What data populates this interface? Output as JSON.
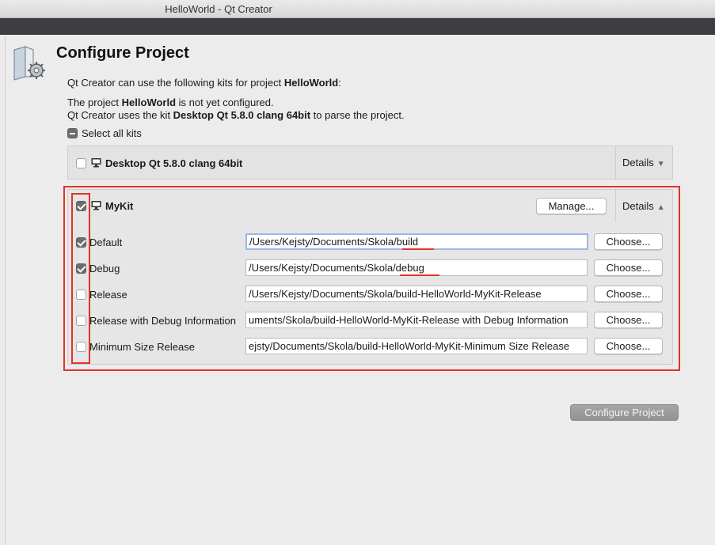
{
  "window": {
    "title": "HelloWorld - Qt Creator"
  },
  "page": {
    "heading": "Configure Project",
    "intro_prefix": "Qt Creator can use the following kits for project ",
    "intro_project": "HelloWorld",
    "intro_suffix": ":",
    "status1_prefix": "The project ",
    "status1_project": "HelloWorld",
    "status1_suffix": " is not yet configured.",
    "status2_prefix": "Qt Creator uses the kit ",
    "status2_kit": "Desktop Qt 5.8.0 clang 64bit",
    "status2_suffix": " to parse the project.",
    "select_all_label": "Select all kits"
  },
  "kits": [
    {
      "name": "Desktop Qt 5.8.0 clang 64bit",
      "checked": false,
      "details_label": "Details",
      "expanded": false
    },
    {
      "name": "MyKit",
      "checked": true,
      "details_label": "Details",
      "expanded": true,
      "manage_label": "Manage...",
      "builds": [
        {
          "label": "Default",
          "checked": true,
          "path": "/Users/Kejsty/Documents/Skola/build",
          "choose_label": "Choose..."
        },
        {
          "label": "Debug",
          "checked": true,
          "path": "/Users/Kejsty/Documents/Skola/debug",
          "choose_label": "Choose..."
        },
        {
          "label": "Release",
          "checked": false,
          "path": "/Users/Kejsty/Documents/Skola/build-HelloWorld-MyKit-Release",
          "choose_label": "Choose..."
        },
        {
          "label": "Release with Debug Information",
          "checked": false,
          "path": "uments/Skola/build-HelloWorld-MyKit-Release with Debug Information",
          "choose_label": "Choose..."
        },
        {
          "label": "Minimum Size Release",
          "checked": false,
          "path": "ejsty/Documents/Skola/build-HelloWorld-MyKit-Minimum Size Release",
          "choose_label": "Choose..."
        }
      ]
    }
  ],
  "footer": {
    "configure_label": "Configure Project"
  },
  "colors": {
    "annotation": "#e2332a",
    "focus_ring": "#9ab8e6"
  }
}
